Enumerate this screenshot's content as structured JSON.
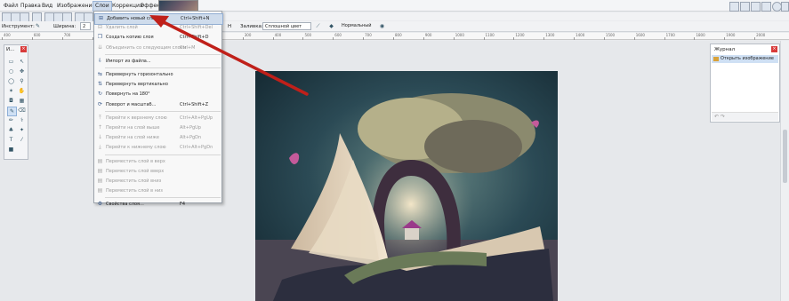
{
  "menubar": {
    "items": [
      "Файл",
      "Правка",
      "Вид",
      "Изображение",
      "Слои",
      "Коррекция",
      "Эффекты"
    ],
    "active_index": 4
  },
  "toolbar": {
    "tool_label": "Инструмент:",
    "width_label": "Ширина:",
    "width_value": "2",
    "fill_label": "Заливка:",
    "fill_value": "Сплошной цвет",
    "blend_value": "Нормальный"
  },
  "ruler": {
    "ticks": [
      "400",
      "600",
      "700",
      "800",
      "900",
      "1000",
      "100",
      "200",
      "300",
      "400",
      "500",
      "600",
      "700",
      "800",
      "900",
      "1000",
      "1100",
      "1200",
      "1300",
      "1400",
      "1500",
      "1600",
      "1700",
      "1800",
      "1900",
      "2000"
    ]
  },
  "tools_panel": {
    "title": "И..."
  },
  "layers_menu": {
    "items": [
      {
        "label": "Добавить новый слой",
        "shortcut": "Ctrl+Shift+N",
        "icon": "add-layer-icon",
        "disabled": false,
        "highlight": true
      },
      {
        "label": "Удалить слой",
        "shortcut": "Ctrl+Shift+Del",
        "icon": "delete-layer-icon",
        "disabled": true
      },
      {
        "label": "Создать копию слоя",
        "shortcut": "Ctrl+Shift+D",
        "icon": "duplicate-layer-icon",
        "disabled": false
      },
      {
        "label": "Объединить со следующим слоем",
        "shortcut": "Ctrl+M",
        "icon": "merge-down-icon",
        "disabled": true
      },
      {
        "label": "Импорт из файла...",
        "shortcut": "",
        "icon": "import-icon",
        "disabled": false
      },
      {
        "label": "Перевернуть горизонтально",
        "shortcut": "",
        "icon": "flip-horizontal-icon",
        "disabled": false
      },
      {
        "label": "Перевернуть вертикально",
        "shortcut": "",
        "icon": "flip-vertical-icon",
        "disabled": false
      },
      {
        "label": "Повернуть на 180°",
        "shortcut": "",
        "icon": "rotate-180-icon",
        "disabled": false
      },
      {
        "label": "Поворот и масштаб...",
        "shortcut": "Ctrl+Shift+Z",
        "icon": "rotate-zoom-icon",
        "disabled": false
      },
      {
        "label": "Перейти к верхнему слою",
        "shortcut": "Ctrl+Alt+PgUp",
        "icon": "go-top-layer-icon",
        "disabled": true
      },
      {
        "label": "Перейти на слой выше",
        "shortcut": "Alt+PgUp",
        "icon": "go-layer-up-icon",
        "disabled": true
      },
      {
        "label": "Перейти на слой ниже",
        "shortcut": "Alt+PgDn",
        "icon": "go-layer-down-icon",
        "disabled": true
      },
      {
        "label": "Перейти к нижнему слою",
        "shortcut": "Ctrl+Alt+PgDn",
        "icon": "go-bottom-layer-icon",
        "disabled": true
      },
      {
        "label": "Переместить слой в верх",
        "shortcut": "",
        "icon": "move-layer-top-icon",
        "disabled": true
      },
      {
        "label": "Переместить слой вверх",
        "shortcut": "",
        "icon": "move-layer-up-icon",
        "disabled": true
      },
      {
        "label": "Переместить слой вниз",
        "shortcut": "",
        "icon": "move-layer-down-icon",
        "disabled": true
      },
      {
        "label": "Переместить слой в низ",
        "shortcut": "",
        "icon": "move-layer-bottom-icon",
        "disabled": true
      },
      {
        "label": "Свойства слоя...",
        "shortcut": "F4",
        "icon": "layer-properties-icon",
        "disabled": false
      }
    ]
  },
  "history_panel": {
    "title": "Журнал",
    "entries": [
      "Открыть изображение"
    ]
  },
  "colors": {
    "accent": "#cfdcec",
    "close": "#d83b3b",
    "arrow": "#c0201a"
  }
}
